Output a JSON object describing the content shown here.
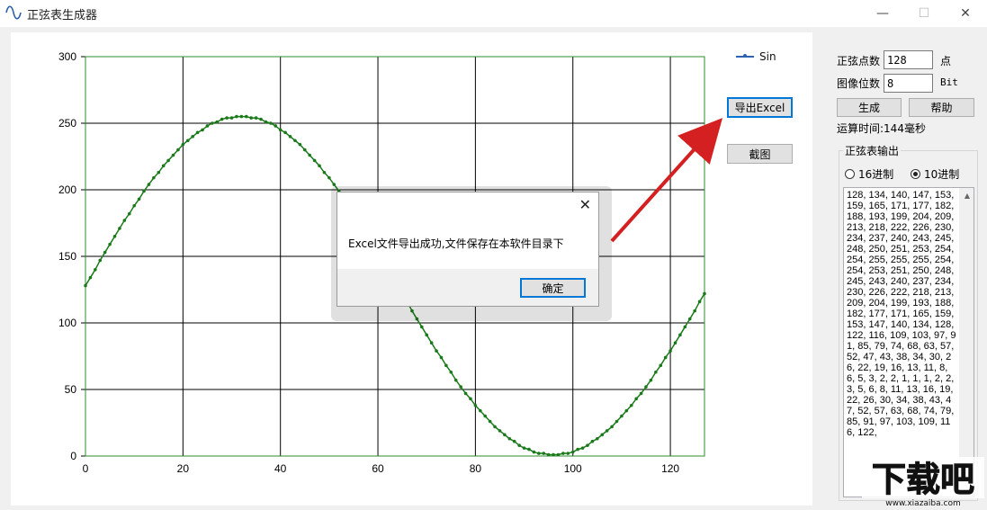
{
  "window": {
    "title": "正弦表生成器",
    "minimize": "—",
    "maximize": "☐",
    "close": "✕"
  },
  "chart_data": {
    "type": "line",
    "title": "",
    "xlabel": "",
    "ylabel": "",
    "xlim": [
      0,
      127
    ],
    "ylim": [
      0,
      300
    ],
    "x_ticks": [
      "0",
      "20",
      "40",
      "60",
      "80",
      "100",
      "120"
    ],
    "y_ticks": [
      "0",
      "50",
      "100",
      "150",
      "200",
      "250",
      "300"
    ],
    "grid": true,
    "legend_position": "top-right",
    "series": [
      {
        "name": "Sin",
        "color": "#1a7a1a",
        "values": [
          128,
          134,
          140,
          147,
          153,
          159,
          165,
          171,
          177,
          182,
          188,
          193,
          199,
          204,
          209,
          213,
          218,
          222,
          226,
          230,
          234,
          237,
          240,
          243,
          245,
          248,
          250,
          251,
          253,
          254,
          254,
          255,
          255,
          255,
          254,
          254,
          253,
          251,
          250,
          248,
          245,
          243,
          240,
          237,
          234,
          230,
          226,
          222,
          218,
          213,
          209,
          204,
          199,
          193,
          188,
          182,
          177,
          171,
          165,
          159,
          153,
          147,
          140,
          134,
          128,
          122,
          116,
          109,
          103,
          97,
          91,
          85,
          79,
          74,
          68,
          63,
          57,
          52,
          47,
          43,
          38,
          34,
          30,
          26,
          22,
          19,
          16,
          13,
          11,
          8,
          6,
          5,
          3,
          2,
          2,
          1,
          1,
          1,
          2,
          2,
          3,
          5,
          6,
          8,
          11,
          13,
          16,
          19,
          22,
          26,
          30,
          34,
          38,
          43,
          47,
          52,
          57,
          63,
          68,
          74,
          79,
          85,
          91,
          97,
          103,
          109,
          116,
          122
        ]
      }
    ]
  },
  "legend": {
    "label": "Sin"
  },
  "buttons": {
    "export_excel": "导出Excel",
    "screenshot": "截图",
    "generate": "生成",
    "help": "帮助"
  },
  "settings": {
    "points_label": "正弦点数",
    "points_value": "128",
    "points_unit": "点",
    "bits_label": "图像位数",
    "bits_value": "8",
    "bits_unit": "Bit",
    "elapsed": "运算时间:144毫秒"
  },
  "output": {
    "group_title": "正弦表输出",
    "radio_hex": "16进制",
    "radio_dec": "10进制",
    "selected": "10进制",
    "text": "128, 134, 140, 147, 153, 159, 165, 171, 177, 182, 188, 193, 199, 204, 209, 213, 218, 222, 226, 230, 234, 237, 240, 243, 245, 248, 250, 251, 253, 254, 254, 255, 255, 255, 254, 254, 253, 251, 250, 248, 245, 243, 240, 237, 234, 230, 226, 222, 218, 213, 209, 204, 199, 193, 188, 182, 177, 171, 165, 159, 153, 147, 140, 134, 128, 122, 116, 109, 103, 97, 91, 85, 79, 74, 68, 63, 57, 52, 47, 43, 38, 34, 30, 26, 22, 19, 16, 13, 11, 8, 6, 5, 3, 2, 2, 1, 1, 1, 2, 2, 3, 5, 6, 8, 11, 13, 16, 19, 22, 26, 30, 34, 38, 43, 47, 52, 57, 63, 68, 74, 79, 85, 91, 97, 103, 109, 116, 122,"
  },
  "dialog": {
    "message": "Excel文件导出成功,文件保存在本软件目录下",
    "ok": "确定",
    "close": "✕"
  },
  "watermark": {
    "text": "下载吧",
    "url": "www.xiazaiba.com"
  },
  "colors": {
    "series": "#1a7a1a",
    "accent": "#0078d7",
    "arrow": "#d42020"
  }
}
